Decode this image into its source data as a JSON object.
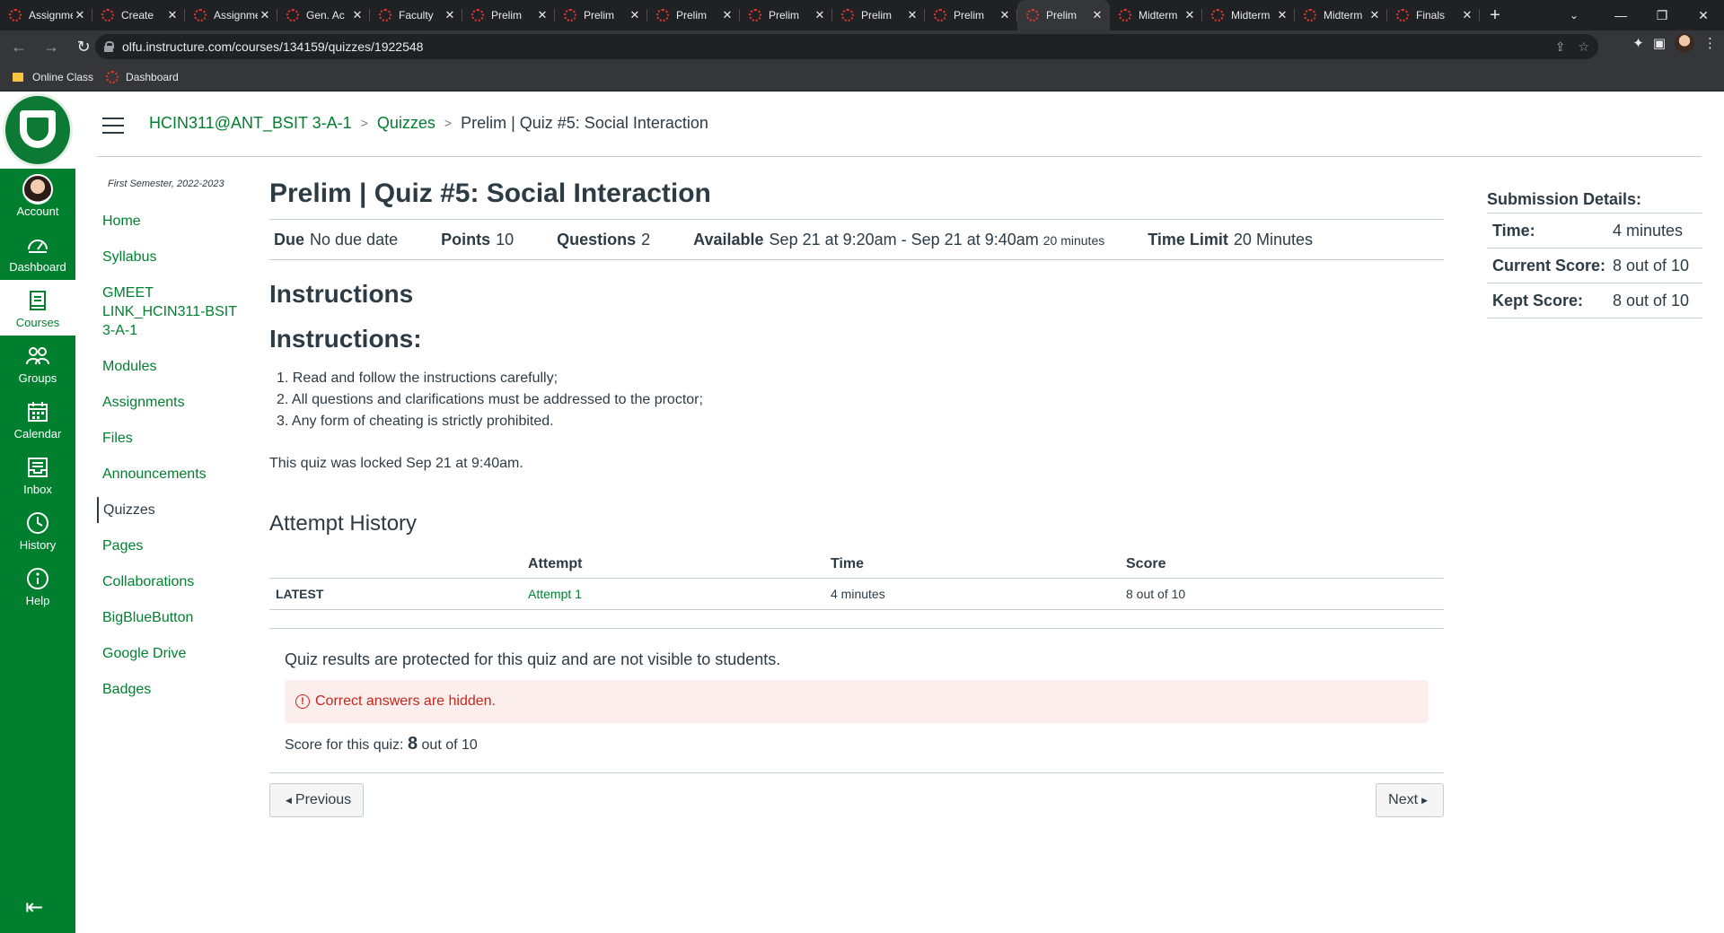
{
  "browser": {
    "tabs": [
      {
        "title": "Assignment"
      },
      {
        "title": "Create"
      },
      {
        "title": "Assignment"
      },
      {
        "title": "Gen. Ac"
      },
      {
        "title": "Faculty"
      },
      {
        "title": "Prelim"
      },
      {
        "title": "Prelim"
      },
      {
        "title": "Prelim"
      },
      {
        "title": "Prelim"
      },
      {
        "title": "Prelim"
      },
      {
        "title": "Prelim"
      },
      {
        "title": "Prelim"
      },
      {
        "title": "Midterm"
      },
      {
        "title": "Midterm"
      },
      {
        "title": "Midterm"
      },
      {
        "title": "Finals"
      }
    ],
    "active_tab_index": 11,
    "url": "olfu.instructure.com/courses/134159/quizzes/1922548",
    "bookmarks": [
      {
        "label": "Online Class",
        "icon": "folder-icon"
      },
      {
        "label": "Dashboard",
        "icon": "canvas-icon"
      }
    ]
  },
  "global_nav": {
    "items": [
      {
        "key": "account",
        "label": "Account",
        "icon": "avatar"
      },
      {
        "key": "dashboard",
        "label": "Dashboard",
        "icon": "dashboard-icon"
      },
      {
        "key": "courses",
        "label": "Courses",
        "icon": "courses-icon"
      },
      {
        "key": "groups",
        "label": "Groups",
        "icon": "groups-icon"
      },
      {
        "key": "calendar",
        "label": "Calendar",
        "icon": "calendar-icon"
      },
      {
        "key": "inbox",
        "label": "Inbox",
        "icon": "inbox-icon"
      },
      {
        "key": "history",
        "label": "History",
        "icon": "history-icon"
      },
      {
        "key": "help",
        "label": "Help",
        "icon": "help-icon"
      }
    ],
    "active": "courses"
  },
  "breadcrumb": {
    "course": "HCIN311@ANT_BSIT 3-A-1",
    "section": "Quizzes",
    "current": "Prelim | Quiz #5: Social Interaction"
  },
  "course_nav": {
    "term": "First Semester, 2022-2023",
    "items": [
      {
        "label": "Home"
      },
      {
        "label": "Syllabus"
      },
      {
        "label": "GMEET LINK_HCIN311-BSIT 3-A-1"
      },
      {
        "label": "Modules"
      },
      {
        "label": "Assignments"
      },
      {
        "label": "Files"
      },
      {
        "label": "Announcements"
      },
      {
        "label": "Quizzes"
      },
      {
        "label": "Pages"
      },
      {
        "label": "Collaborations"
      },
      {
        "label": "BigBlueButton"
      },
      {
        "label": "Google Drive"
      },
      {
        "label": "Badges"
      }
    ],
    "active": "Quizzes"
  },
  "quiz": {
    "title": "Prelim | Quiz #5: Social Interaction",
    "due_label": "Due",
    "due_value": "No due date",
    "points_label": "Points",
    "points_value": "10",
    "questions_label": "Questions",
    "questions_value": "2",
    "available_label": "Available",
    "available_value": "Sep 21 at 9:20am - Sep 21 at 9:40am",
    "available_duration": "20 minutes",
    "time_limit_label": "Time Limit",
    "time_limit_value": "20 Minutes",
    "instructions_heading": "Instructions",
    "instructions_subheading": "Instructions:",
    "instructions": [
      "1. Read and follow the instructions carefully;",
      "2. All questions and clarifications must be addressed to the proctor;",
      "3. Any form of cheating is strictly prohibited."
    ],
    "locked_note": "This quiz was locked Sep 21 at 9:40am."
  },
  "attempt_history": {
    "heading": "Attempt History",
    "columns": [
      "",
      "Attempt",
      "Time",
      "Score"
    ],
    "rows": [
      {
        "label": "LATEST",
        "attempt": "Attempt 1",
        "time": "4 minutes",
        "score": "8 out of 10"
      }
    ]
  },
  "results": {
    "protected_note": "Quiz results are protected for this quiz and are not visible to students.",
    "alert": "Correct answers are hidden.",
    "score_prefix": "Score for this quiz:",
    "score_value": "8",
    "score_suffix": "out of 10"
  },
  "pager": {
    "previous": "Previous",
    "next": "Next"
  },
  "submission": {
    "title": "Submission Details:",
    "time_label": "Time:",
    "time_value": "4 minutes",
    "current_label": "Current Score:",
    "current_value": "8 out of 10",
    "kept_label": "Kept Score:",
    "kept_value": "8 out of 10"
  },
  "colors": {
    "brand": "#00802f",
    "text": "#2d3b45",
    "alert": "#c9261c",
    "alert_bg": "#fbeeed"
  }
}
